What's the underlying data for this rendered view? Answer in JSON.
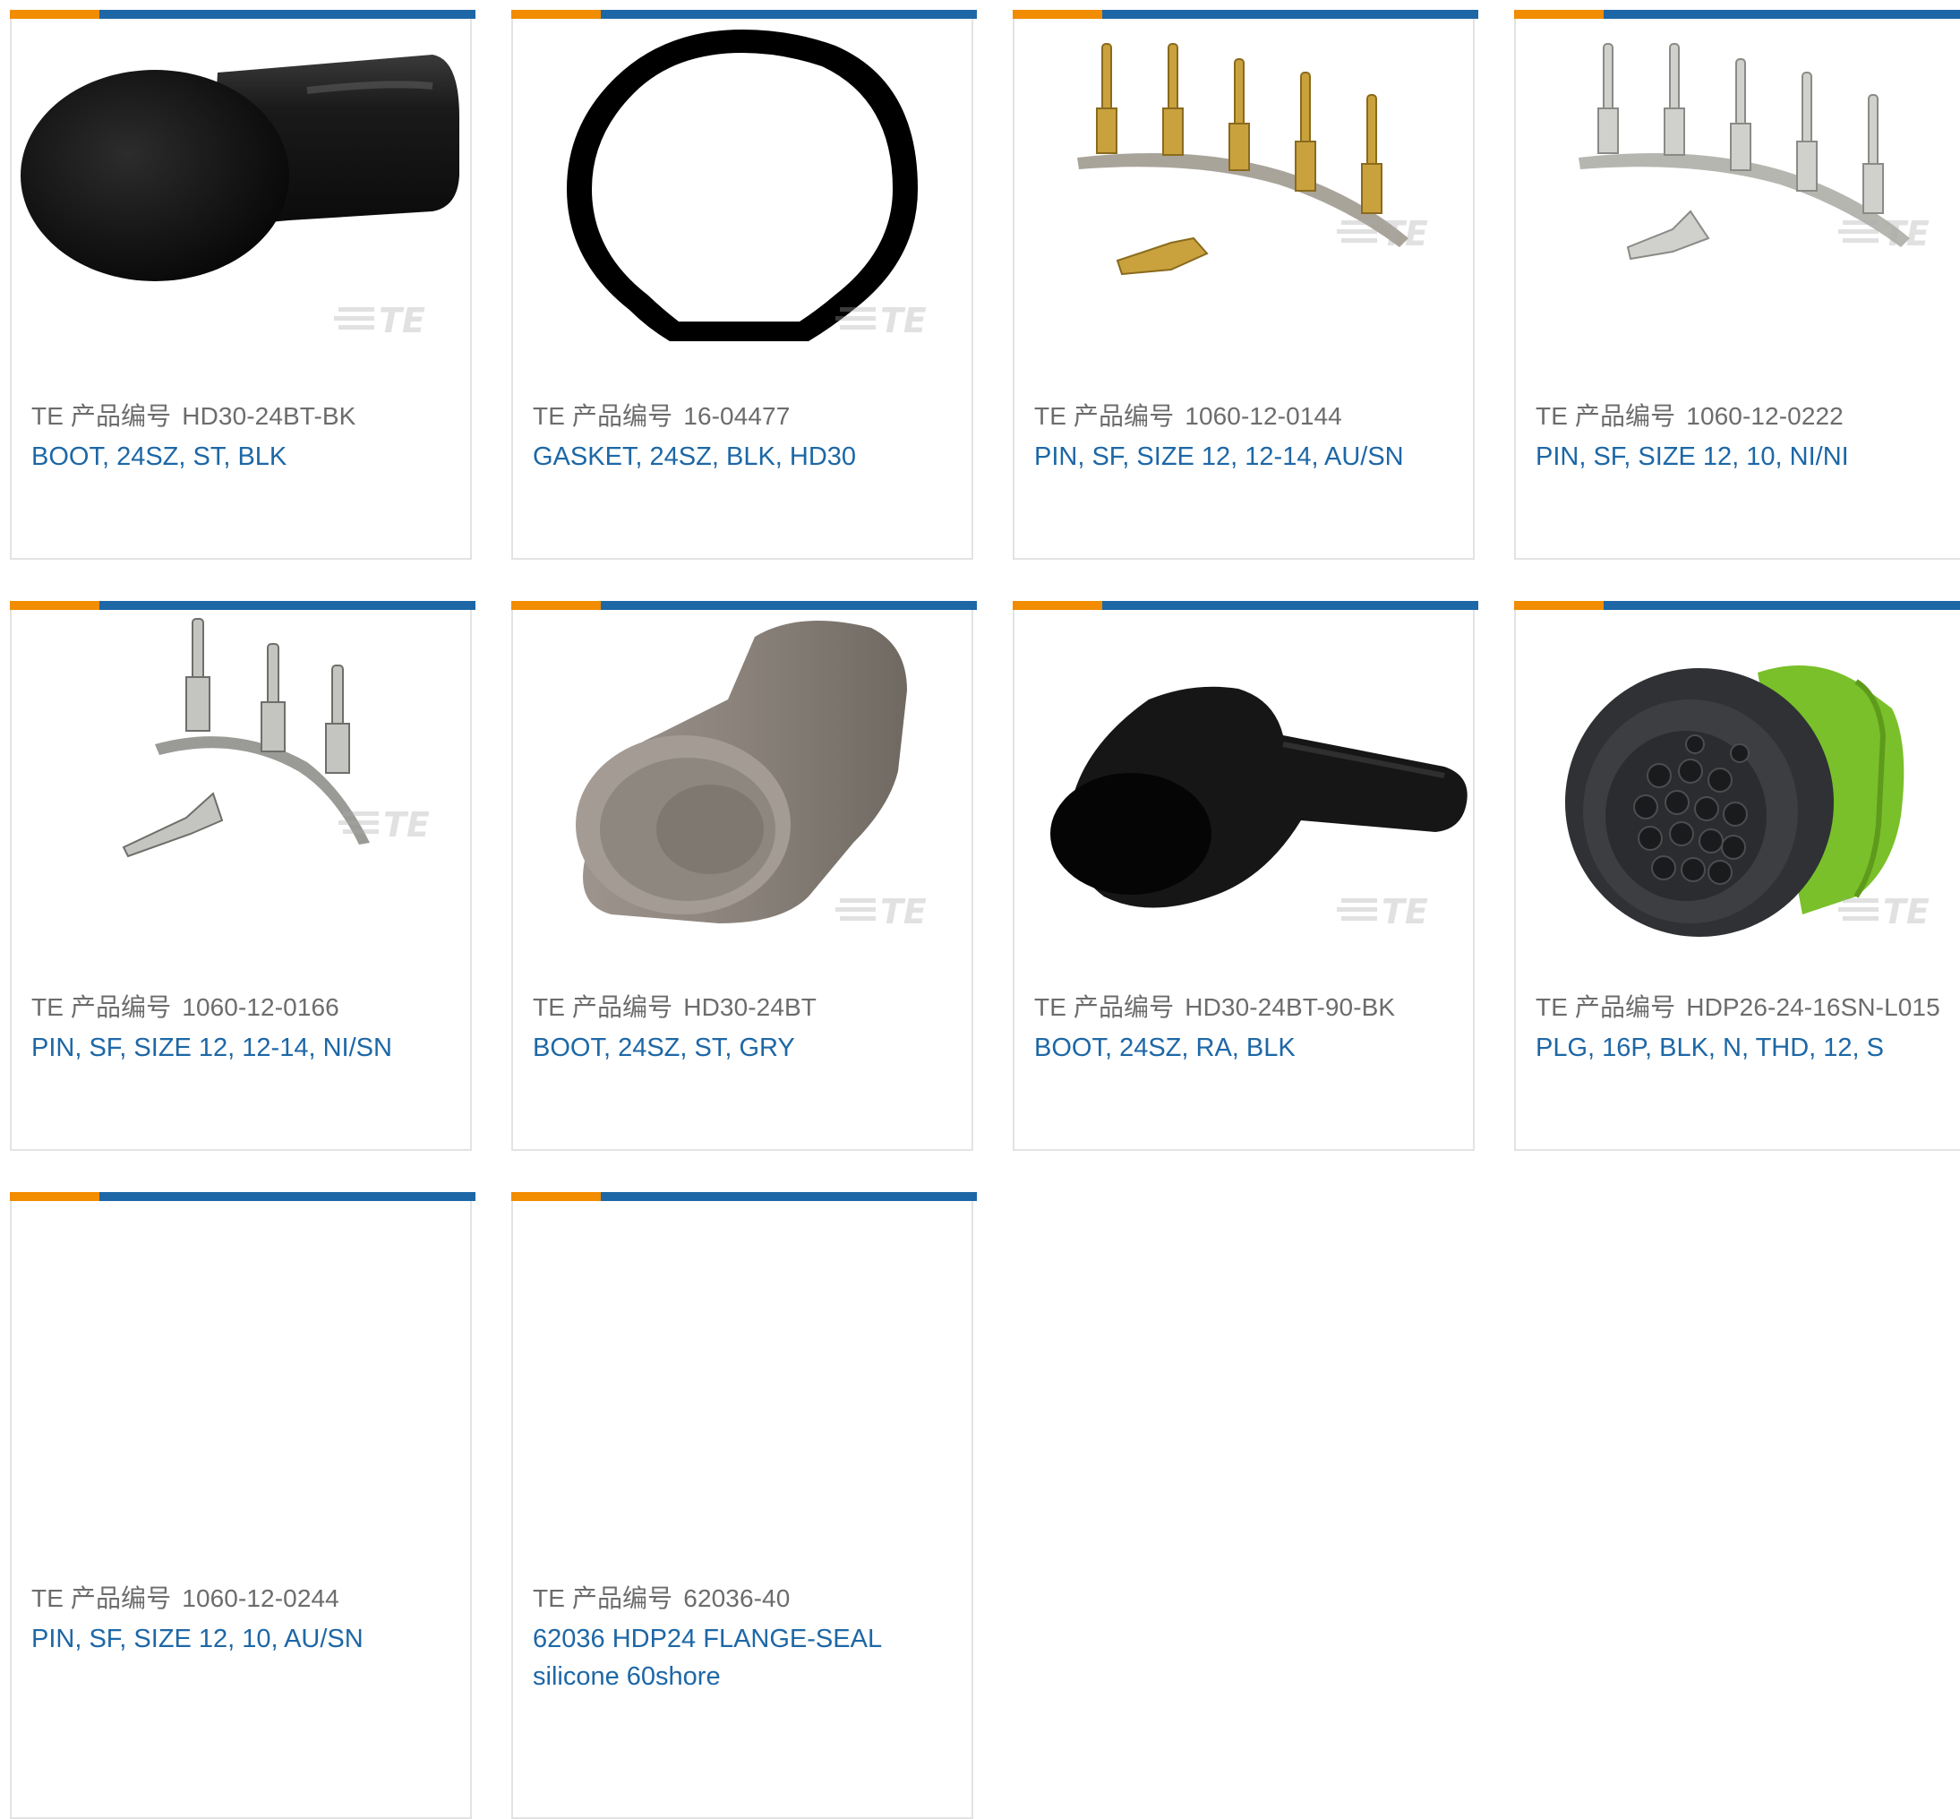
{
  "part_number_label": "TE 产品编号",
  "watermark": "TE",
  "products": [
    {
      "part_number": "HD30-24BT-BK",
      "description": "BOOT, 24SZ, ST, BLK",
      "image": "black-boot-straight"
    },
    {
      "part_number": "16-04477",
      "description": "GASKET, 24SZ, BLK, HD30",
      "image": "black-ring-gasket"
    },
    {
      "part_number": "1060-12-0144",
      "description": "PIN, SF, SIZE 12, 12-14, AU/SN",
      "image": "gold-pin-strip"
    },
    {
      "part_number": "1060-12-0222",
      "description": "PIN, SF, SIZE 12, 10, NI/NI",
      "image": "silver-pin-strip"
    },
    {
      "part_number": "1060-12-0166",
      "description": "PIN, SF, SIZE 12, 12-14, NI/SN",
      "image": "silver-pin-strip-three"
    },
    {
      "part_number": "HD30-24BT",
      "description": "BOOT, 24SZ, ST, GRY",
      "image": "gray-boot-straight"
    },
    {
      "part_number": "HD30-24BT-90-BK",
      "description": "BOOT, 24SZ, RA, BLK",
      "image": "black-boot-right-angle"
    },
    {
      "part_number": "HDP26-24-16SN-L015",
      "description": "PLG, 16P, BLK, N, THD, 12, S",
      "image": "circular-plug-connector"
    },
    {
      "part_number": "1060-12-0244",
      "description": "PIN, SF, SIZE 12, 10, AU/SN",
      "image": "none"
    },
    {
      "part_number": "62036-40",
      "description": "62036 HDP24 FLANGE-SEAL silicone 60shore",
      "image": "none"
    }
  ],
  "colors": {
    "accent_orange": "#f28c00",
    "accent_blue": "#1d67a6",
    "label_gray": "#6c6c6c",
    "border_gray": "#e3e3e3"
  }
}
